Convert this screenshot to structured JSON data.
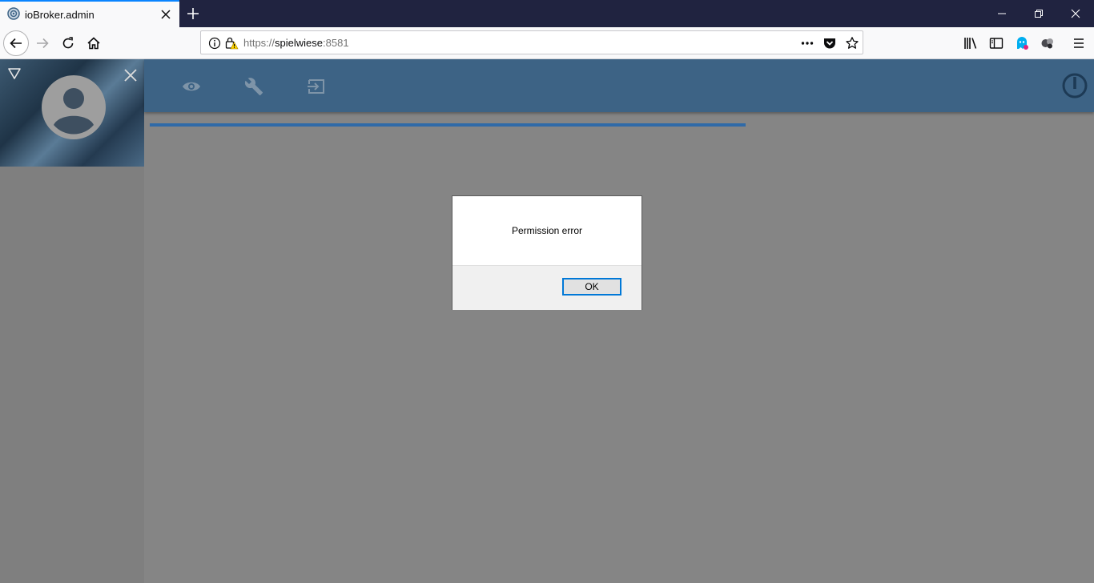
{
  "browser": {
    "tab": {
      "title": "ioBroker.admin"
    },
    "url": {
      "scheme": "https://",
      "host": "spielwiese",
      "port": ":8581"
    }
  },
  "dialog": {
    "message": "Permission error",
    "ok_label": "OK"
  }
}
